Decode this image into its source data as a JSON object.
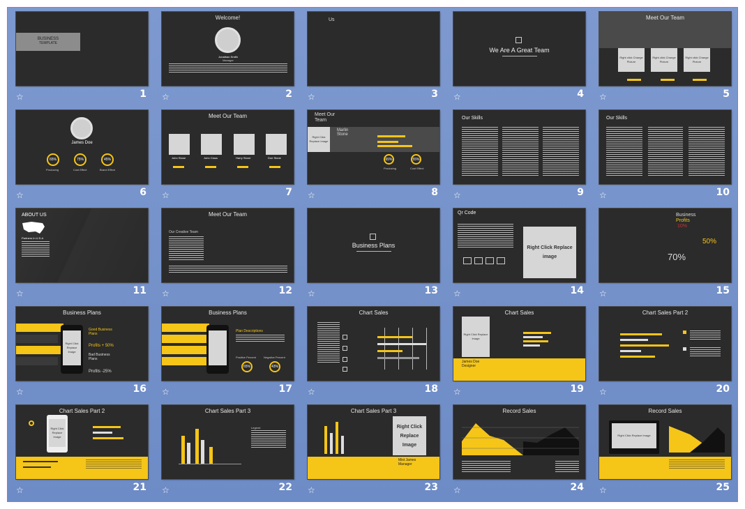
{
  "slides": [
    {
      "num": "1",
      "title": "BUSINESS",
      "subtitle": "TEMPLATE"
    },
    {
      "num": "2",
      "title": "Welcome!",
      "photo": "Right click\nChange Picture",
      "name": "Jonathan Smith",
      "role": "Manager"
    },
    {
      "num": "3",
      "title": "Us"
    },
    {
      "num": "4",
      "title": "We Are A Great Team"
    },
    {
      "num": "5",
      "title": "Meet Our Team",
      "photos": [
        "Right click\nChange Picture",
        "Right click\nChange Picture",
        "Right click\nChange Picture"
      ]
    },
    {
      "num": "6",
      "name": "James Doe",
      "photo": "Right click\nChange Picture",
      "stats": [
        "65%",
        "75%",
        "45%"
      ],
      "labels": [
        "Producing",
        "Cost Effect",
        "Brand Effect"
      ]
    },
    {
      "num": "7",
      "title": "Meet Our Team",
      "names": [
        "John Stone",
        "John Claus",
        "Harry Stone",
        "Doe Stone"
      ]
    },
    {
      "num": "8",
      "title": "Meet Our Team",
      "photo": "Right Click\nReplace Image",
      "name": "Marlin Stone",
      "stats": [
        "65%",
        "55%"
      ],
      "labels": [
        "Producing",
        "Cost Effect"
      ]
    },
    {
      "num": "9",
      "title": "Our Skills"
    },
    {
      "num": "10",
      "title": "Our Skills"
    },
    {
      "num": "11",
      "title": "ABOUT US",
      "caption": "Partners In U.S.A"
    },
    {
      "num": "12",
      "title": "Meet Our Team",
      "subtitle": "Our Creative Team"
    },
    {
      "num": "13",
      "title": "Business Plans"
    },
    {
      "num": "14",
      "title": "Qr Code",
      "photo": "Right Click\nReplace image"
    },
    {
      "num": "15",
      "title": "Business",
      "subtitle": "Profits",
      "values": [
        "10%",
        "50%",
        "70%"
      ]
    },
    {
      "num": "16",
      "title": "Business Plans",
      "photo": "Right Click\nReplace Image",
      "good": "Good Business Plans",
      "good_value": "Profits + 50%",
      "bad": "Bad Business Plans",
      "bad_value": "Profits -25%"
    },
    {
      "num": "17",
      "title": "Business Plans",
      "desc": "Plan Descriptions",
      "stats": [
        "65%",
        "43%"
      ],
      "labels": [
        "Positive Percent",
        "Negative Percent"
      ]
    },
    {
      "num": "18",
      "title": "Chart Sales"
    },
    {
      "num": "19",
      "title": "Chart Sales",
      "photo": "Right Click\nReplace Image",
      "name": "James Doe",
      "role": "Designer"
    },
    {
      "num": "20",
      "title": "Chart Sales Part 2"
    },
    {
      "num": "21",
      "title": "Chart Sales Part 2",
      "photo": "Right Click\nReplace Image"
    },
    {
      "num": "22",
      "title": "Chart Sales Part 3",
      "legend": "Legend"
    },
    {
      "num": "23",
      "title": "Chart Sales Part 3",
      "photo": "Right Click\nReplace Image",
      "name": "Mist James",
      "role": "Manager"
    },
    {
      "num": "24",
      "title": "Record Sales"
    },
    {
      "num": "25",
      "title": "Record Sales",
      "photo": "Right Click\nReplace Image"
    }
  ],
  "colors": {
    "accent": "#f5c518",
    "slide_bg": "#2b2b2b",
    "panel_bg": "#6d8bc6"
  },
  "icon": "star-icon"
}
